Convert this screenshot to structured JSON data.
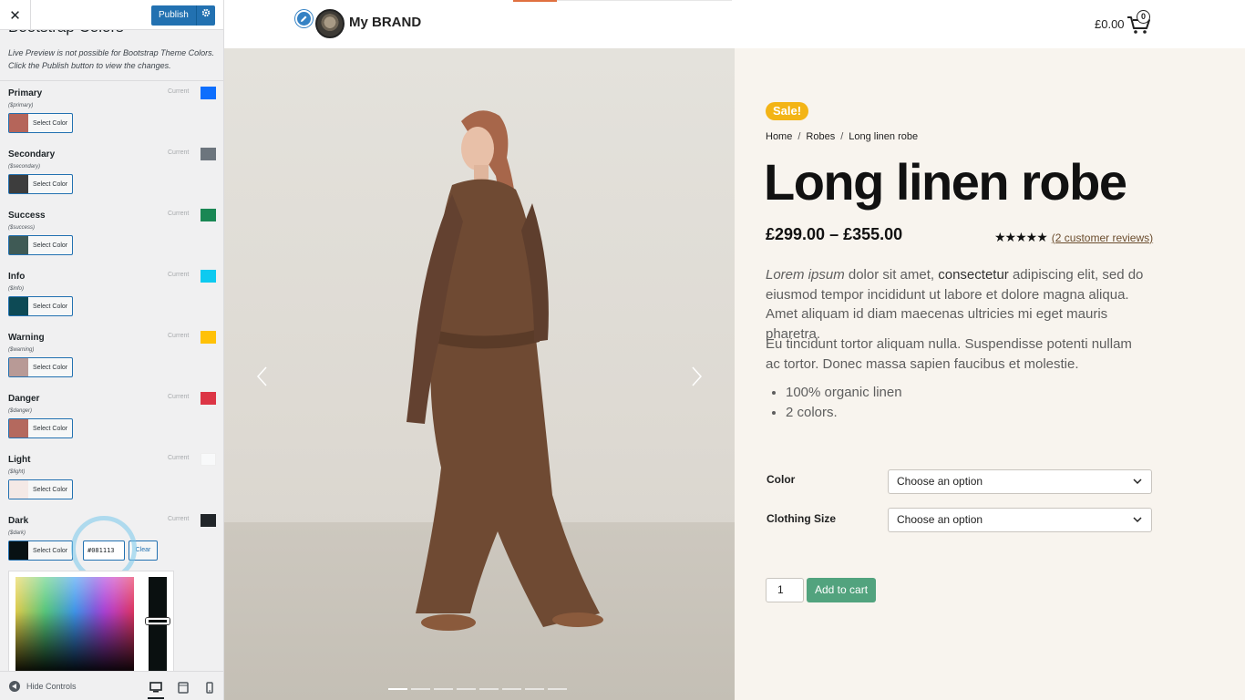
{
  "sidebar": {
    "close_label": "✕",
    "publish_label": "Publish",
    "panel_title": "Bootstrap Colors",
    "description": "Live Preview is not possible for Bootstrap Theme Colors. Click the Publish button to view the changes.",
    "current_label": "Current",
    "select_color_label": "Select Color",
    "colors": [
      {
        "title": "Primary",
        "var": "($primary)",
        "swatch": "#b5655a",
        "current": "#0d6efd"
      },
      {
        "title": "Secondary",
        "var": "($secondary)",
        "swatch": "#3d3d3d",
        "current": "#6c757d"
      },
      {
        "title": "Success",
        "var": "($success)",
        "swatch": "#3f5a55",
        "current": "#198754"
      },
      {
        "title": "Info",
        "var": "($info)",
        "swatch": "#0d4a55",
        "current": "#0dcaf0"
      },
      {
        "title": "Warning",
        "var": "($warning)",
        "swatch": "#b89a96",
        "current": "#ffc107"
      },
      {
        "title": "Danger",
        "var": "($danger)",
        "swatch": "#b4695e",
        "current": "#dc3545"
      },
      {
        "title": "Light",
        "var": "($light)",
        "swatch": "#f4e9e6",
        "current": "#f8f9fa"
      },
      {
        "title": "Dark",
        "var": "($dark)",
        "swatch": "#081113",
        "current": "#212529"
      }
    ],
    "dark_hex_value": "#081113",
    "clear_label": "Clear",
    "hide_controls_label": "Hide Controls",
    "devices": [
      "desktop",
      "tablet",
      "mobile"
    ],
    "active_device": "desktop"
  },
  "site": {
    "brand_name": "My BRAND",
    "cart_total": "£0.00",
    "cart_count": "0"
  },
  "product": {
    "sale_badge": "Sale!",
    "breadcrumb": [
      "Home",
      "Robes",
      "Long linen robe"
    ],
    "title": "Long linen robe",
    "price": "£299.00 – £355.00",
    "stars": "★★★★★",
    "rating": 5,
    "reviews_link": "(2 customer reviews)",
    "description_1_em": "Lorem ipsum",
    "description_1_a": " dolor sit amet, ",
    "description_1_b": "consectetur",
    "description_1_c": " adipiscing elit, sed do eiusmod tempor incididunt ut labore et dolore magna aliqua. Amet aliquam id diam maecenas ultricies mi eget mauris pharetra.",
    "description_2": "Eu tincidunt tortor aliquam nulla. Suspendisse potenti nullam ac tortor. Donec massa sapien faucibus et molestie.",
    "features": [
      "100% organic linen",
      "2 colors."
    ],
    "color_label": "Color",
    "size_label": "Clothing Size",
    "select_placeholder": "Choose an option",
    "quantity": "1",
    "add_to_cart_label": "Add to cart",
    "gallery_slides": 8,
    "gallery_active_slide": 1
  },
  "colors": {
    "wp_blue": "#2271b1",
    "add_to_cart": "#52a37e",
    "sale_badge": "#f3b416",
    "summary_bg": "#f8f4ee"
  }
}
